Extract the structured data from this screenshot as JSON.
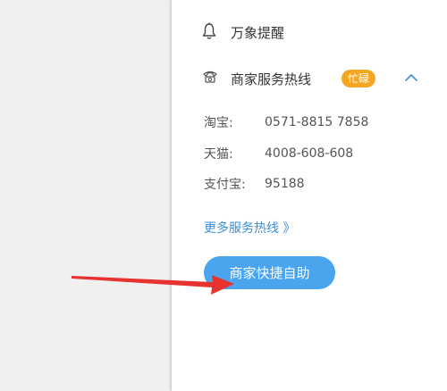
{
  "panel": {
    "reminder_title": "万象提醒",
    "hotline_title": "商家服务热线",
    "busy_badge": "忙碌",
    "hotlines": [
      {
        "label": "淘宝:",
        "number": "0571-8815 7858"
      },
      {
        "label": "天猫:",
        "number": "4008-608-608"
      },
      {
        "label": "支付宝:",
        "number": "95188"
      }
    ],
    "more_link": "更多服务热线 》",
    "self_service_button": "商家快捷自助"
  },
  "colors": {
    "accent_blue": "#4aa5ee",
    "link_blue": "#3b8fd9",
    "badge_orange": "#f5a623",
    "annotation_arrow": "#e8322f"
  },
  "icons": {
    "reminder": "bell-icon",
    "hotline": "phone-icon",
    "collapse": "chevron-up-icon"
  }
}
